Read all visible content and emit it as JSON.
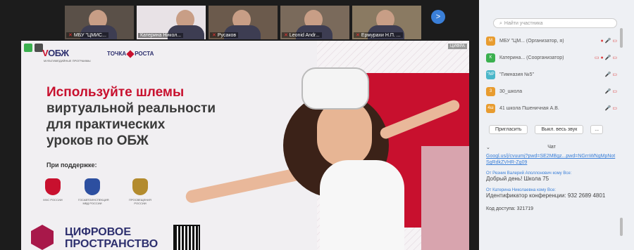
{
  "video_strip": {
    "tiles": [
      {
        "name": "МБУ \"ЦМИС...",
        "muted": true
      },
      {
        "name": "Катерина Никол...",
        "muted": false,
        "is_slide": true
      },
      {
        "name": "Русаков",
        "muted": true
      },
      {
        "name": "Leonid Andr...",
        "muted": true
      },
      {
        "name": "Ермурахи Н.П. ...",
        "muted": true
      }
    ],
    "more_label": ">"
  },
  "slide": {
    "logo": {
      "brand_v": "V",
      "brand_rest": "ОБЖ",
      "tagline": "МУЛЬТИМЕДИЙНЫЕ ПРОГРАММЫ"
    },
    "tochka_label_1": "ТОЧКА",
    "tochka_label_2": "РОСТА",
    "headline": {
      "line1": "Используйте шлемы",
      "line2": "виртуальной реальности",
      "line3": "для практических",
      "line4": "уроков по ОБЖ"
    },
    "support_label": "При поддержке:",
    "emblems": [
      {
        "caption": "МЧС РОССИИ",
        "color": "#c8102e"
      },
      {
        "caption": "ГОСАВТОИНСПЕКЦИЯ МВД РОССИИ",
        "color": "#2d4fa0"
      },
      {
        "caption": "ПРОСВЕЩЕНИЯ РОССИИ",
        "color": "#b38b2e"
      }
    ],
    "cifra_line1": "ЦИФРОВОЕ",
    "cifra_line2": "ПРОСТРАНСТВО",
    "corner_label": "ЦИФРА"
  },
  "panel": {
    "search_placeholder": "Найти участника",
    "participants": [
      {
        "initial": "М",
        "color": "#e89c2f",
        "name": "МБУ \"ЦМ... (Организатор, я)",
        "icons": "● 🎤 ▭"
      },
      {
        "initial": "К",
        "color": "#3bb04f",
        "name": "Катерина... (Соорганизатор)",
        "icons": "▭ ● 🎤 ▭"
      },
      {
        "initial": "\"NP",
        "color": "#49b6c9",
        "name": "\"Гимназия №5\"",
        "icons": "🎤 ▭"
      },
      {
        "initial": "3",
        "color": "#e89c2f",
        "name": "30_школа",
        "icons": "🎤 ▭"
      },
      {
        "initial": "4ш",
        "color": "#e89c2f",
        "name": "41 школа Пшеничная А.В.",
        "icons": "🎤 ▭"
      }
    ],
    "invite_label": "Пригласить",
    "mute_all_label": "Выкл. весь звук",
    "more_label": "...",
    "chat_title": "Чат",
    "chat_link": "Googl.us/j/cvuumj?pwd=SE2MBgz...pwd=NGrnWNgMpNotSgRdkZVHR-Zg09",
    "msg1_from": "От Резник Валерий Аполлонович кому Все:",
    "msg1_text": "Добрый день! Школа 75",
    "msg2_from": "От Катерина Николаевна кому Все:",
    "msg2_text": "Идентификатор конференции: 932 2689 4801",
    "access_code": "Код доступа: 321719"
  }
}
